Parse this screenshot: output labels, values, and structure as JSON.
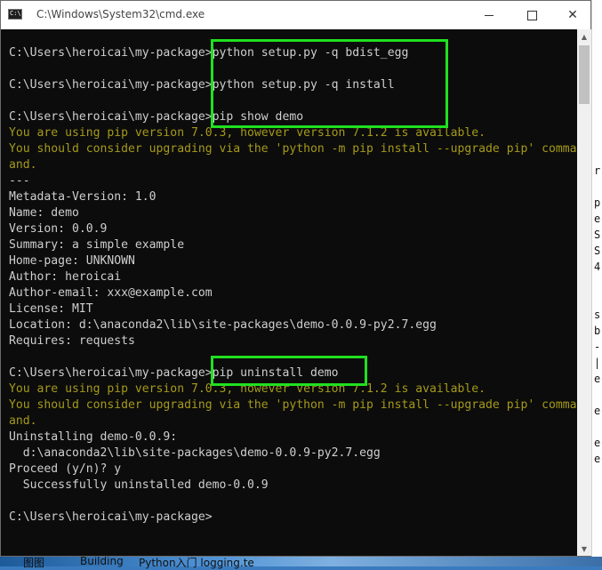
{
  "window": {
    "title": "C:\\Windows\\System32\\cmd.exe",
    "icon_label": "C:\\",
    "minimize_icon": "minimize-icon",
    "maximize_icon": "maximize-icon",
    "close_glyph": "✕"
  },
  "console": {
    "lines": [
      {
        "text": "",
        "color": "white"
      },
      {
        "text": "C:\\Users\\heroicai\\my-package>python setup.py -q bdist_egg",
        "color": "white"
      },
      {
        "text": "",
        "color": "white"
      },
      {
        "text": "C:\\Users\\heroicai\\my-package>python setup.py -q install",
        "color": "white"
      },
      {
        "text": "",
        "color": "white"
      },
      {
        "text": "C:\\Users\\heroicai\\my-package>pip show demo",
        "color": "white"
      },
      {
        "text": "You are using pip version 7.0.3, however version 7.1.2 is available.",
        "color": "yellow"
      },
      {
        "text": "You should consider upgrading via the 'python -m pip install --upgrade pip' comma",
        "color": "yellow"
      },
      {
        "text": "and.",
        "color": "yellow"
      },
      {
        "text": "---",
        "color": "white"
      },
      {
        "text": "Metadata-Version: 1.0",
        "color": "white"
      },
      {
        "text": "Name: demo",
        "color": "white"
      },
      {
        "text": "Version: 0.0.9",
        "color": "white"
      },
      {
        "text": "Summary: a simple example",
        "color": "white"
      },
      {
        "text": "Home-page: UNKNOWN",
        "color": "white"
      },
      {
        "text": "Author: heroicai",
        "color": "white"
      },
      {
        "text": "Author-email: xxx@example.com",
        "color": "white"
      },
      {
        "text": "License: MIT",
        "color": "white"
      },
      {
        "text": "Location: d:\\anaconda2\\lib\\site-packages\\demo-0.0.9-py2.7.egg",
        "color": "white"
      },
      {
        "text": "Requires: requests",
        "color": "white"
      },
      {
        "text": "",
        "color": "white"
      },
      {
        "text": "C:\\Users\\heroicai\\my-package>pip uninstall demo",
        "color": "white"
      },
      {
        "text": "You are using pip version 7.0.3, however version 7.1.2 is available.",
        "color": "yellow"
      },
      {
        "text": "You should consider upgrading via the 'python -m pip install --upgrade pip' comma",
        "color": "yellow"
      },
      {
        "text": "and.",
        "color": "yellow"
      },
      {
        "text": "Uninstalling demo-0.0.9:",
        "color": "white"
      },
      {
        "text": "  d:\\anaconda2\\lib\\site-packages\\demo-0.0.9-py2.7.egg",
        "color": "white"
      },
      {
        "text": "Proceed (y/n)? y",
        "color": "white"
      },
      {
        "text": "  Successfully uninstalled demo-0.0.9",
        "color": "white"
      },
      {
        "text": "",
        "color": "white"
      },
      {
        "text": "C:\\Users\\heroicai\\my-package>",
        "color": "white"
      }
    ]
  },
  "scrollbar": {
    "up_glyph": "▲",
    "down_glyph": "▼"
  },
  "background_window": {
    "fragments": [
      "r",
      "p",
      "e",
      "S",
      "S",
      "4",
      "s",
      "b",
      "-",
      "|",
      "e",
      "e",
      "e",
      "e"
    ]
  },
  "taskbar": {
    "items": [
      "图图",
      "Building",
      "Python入门 logging.te"
    ]
  },
  "colors": {
    "console_text": "#cfcfcf",
    "console_warning": "#a59a1a",
    "highlight": "#20e020",
    "console_bg": "#0c0c0c"
  }
}
